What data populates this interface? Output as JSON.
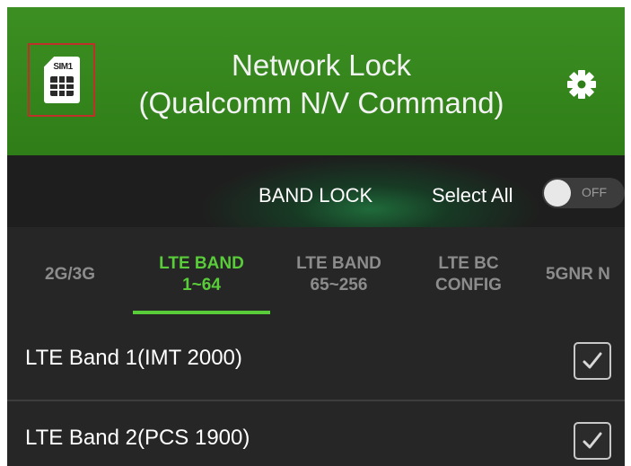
{
  "header": {
    "sim_label": "SIM1",
    "title_line1": "Network Lock",
    "title_line2": "(Qualcomm N/V Command)",
    "icons": [
      "sim-card-icon",
      "gear-icon"
    ]
  },
  "lock_bar": {
    "title": "BAND LOCK",
    "select_all_label": "Select All",
    "toggle_state": "OFF"
  },
  "tabs": [
    {
      "label": "2G/3G",
      "active": false
    },
    {
      "label": "LTE BAND\n1~64",
      "active": true
    },
    {
      "label": "LTE BAND\n65~256",
      "active": false
    },
    {
      "label": "LTE BC\nCONFIG",
      "active": false
    },
    {
      "label": "5GNR N",
      "active": false
    }
  ],
  "bands": [
    {
      "label": "LTE Band 1(IMT 2000)",
      "checked": true
    },
    {
      "label": "LTE Band 2(PCS 1900)",
      "checked": true
    }
  ],
  "colors": {
    "header_green": "#2f7d18",
    "accent_green": "#59cc3a",
    "background": "#262626"
  }
}
